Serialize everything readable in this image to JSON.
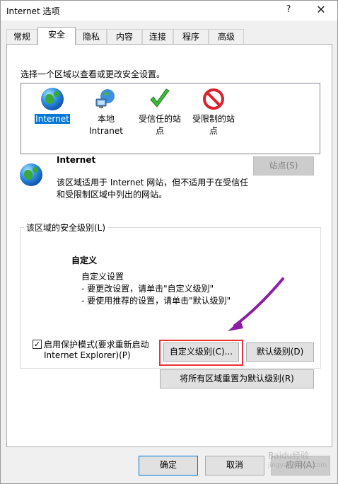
{
  "window": {
    "title": "Internet 选项",
    "help_glyph": "?",
    "close_glyph": "✕"
  },
  "tabs": [
    {
      "label": "常规"
    },
    {
      "label": "安全"
    },
    {
      "label": "隐私"
    },
    {
      "label": "内容"
    },
    {
      "label": "连接"
    },
    {
      "label": "程序"
    },
    {
      "label": "高级"
    }
  ],
  "active_tab": "安全",
  "security": {
    "select_zone_text": "选择一个区域以查看或更改安全设置。",
    "zones": [
      {
        "line1": "Internet",
        "line2": "",
        "icon": "globe-icon",
        "selected": true
      },
      {
        "line1": "本地",
        "line2": "Intranet",
        "icon": "local-intranet-icon",
        "selected": false
      },
      {
        "line1": "受信任的站",
        "line2": "点",
        "icon": "checkmark-icon",
        "selected": false
      },
      {
        "line1": "受限制的站",
        "line2": "点",
        "icon": "no-entry-icon",
        "selected": false
      }
    ],
    "zone_info": {
      "title": "Internet",
      "desc_line1": "该区域适用于 Internet 网站，但不适用于在受信任",
      "desc_line2": "和受限制区域中列出的网站。",
      "sites_button": "站点(S)"
    },
    "level": {
      "group_label": "该区域的安全级别(L)",
      "heading": "自定义",
      "line1": "自定义设置",
      "line2": "- 要更改设置，请单击\"自定义级别\"",
      "line3": "- 要使用推荐的设置，请单击\"默认级别\""
    },
    "protected_mode": {
      "line1": "启用保护模式(要求重新启动",
      "line2": "Internet Explorer)(P)",
      "checked": true,
      "check_glyph": "✓"
    },
    "custom_level_button": "自定义级别(C)...",
    "default_level_button": "默认级别(D)",
    "reset_all_button": "将所有区域重置为默认级别(R)"
  },
  "footer": {
    "ok": "确定",
    "cancel": "取消",
    "apply": "应用(A)"
  },
  "annotation": {
    "arrow_color": "#8a1fa3",
    "highlight_color": "#e8323c"
  },
  "watermark": {
    "line1": "Baidu经验",
    "line2": "jingyan.baidu.com"
  }
}
